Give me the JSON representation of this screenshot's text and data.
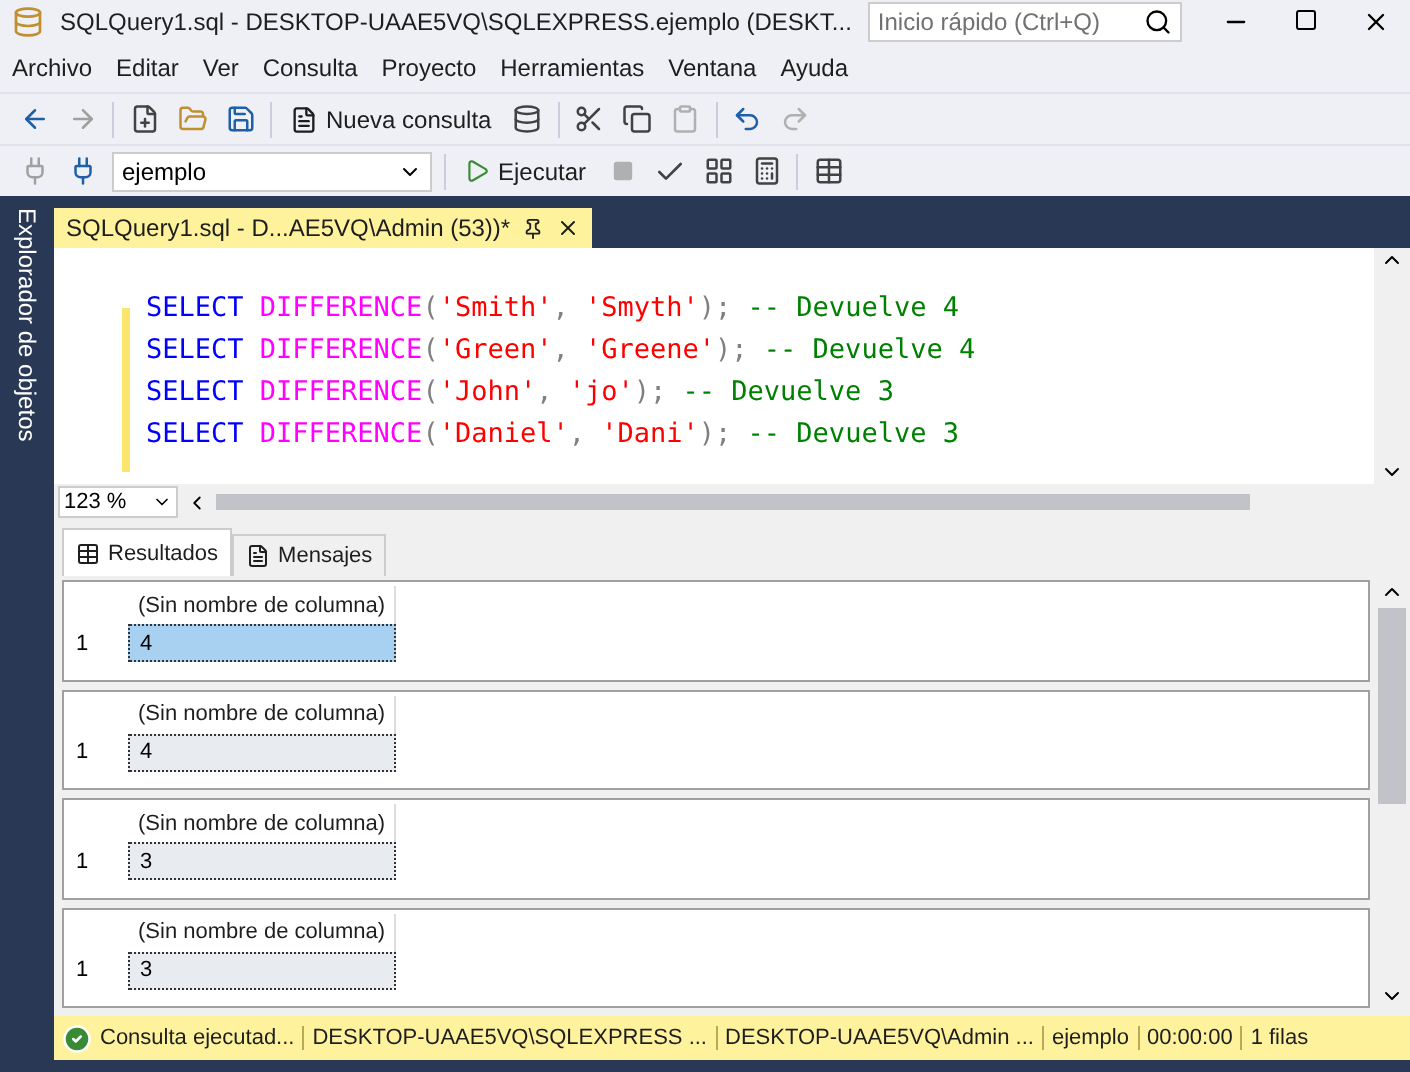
{
  "window": {
    "title": "SQLQuery1.sql - DESKTOP-UAAE5VQ\\SQLEXPRESS.ejemplo (DESKT...",
    "search_placeholder": "Inicio rápido (Ctrl+Q)"
  },
  "menu": [
    "Archivo",
    "Editar",
    "Ver",
    "Consulta",
    "Proyecto",
    "Herramientas",
    "Ventana",
    "Ayuda"
  ],
  "toolbar": {
    "new_query": "Nueva consulta",
    "database": "ejemplo",
    "execute": "Ejecutar"
  },
  "side_tab": "Explorador de objetos",
  "document_tab": {
    "title": "SQLQuery1.sql - D...AE5VQ\\Admin (53))*"
  },
  "editor": {
    "lines": [
      [
        {
          "kind": "keyword",
          "text": "SELECT "
        },
        {
          "kind": "function",
          "text": "DIFFERENCE"
        },
        {
          "kind": "punct",
          "text": "("
        },
        {
          "kind": "string",
          "text": "'Smith'"
        },
        {
          "kind": "punct",
          "text": ", "
        },
        {
          "kind": "string",
          "text": "'Smyth'"
        },
        {
          "kind": "punct",
          "text": "); "
        },
        {
          "kind": "comment",
          "text": "-- Devuelve 4"
        }
      ],
      [
        {
          "kind": "keyword",
          "text": "SELECT "
        },
        {
          "kind": "function",
          "text": "DIFFERENCE"
        },
        {
          "kind": "punct",
          "text": "("
        },
        {
          "kind": "string",
          "text": "'Green'"
        },
        {
          "kind": "punct",
          "text": ", "
        },
        {
          "kind": "string",
          "text": "'Greene'"
        },
        {
          "kind": "punct",
          "text": "); "
        },
        {
          "kind": "comment",
          "text": "-- Devuelve 4"
        }
      ],
      [
        {
          "kind": "keyword",
          "text": "SELECT "
        },
        {
          "kind": "function",
          "text": "DIFFERENCE"
        },
        {
          "kind": "punct",
          "text": "("
        },
        {
          "kind": "string",
          "text": "'John'"
        },
        {
          "kind": "punct",
          "text": ", "
        },
        {
          "kind": "string",
          "text": "'jo'"
        },
        {
          "kind": "punct",
          "text": "); "
        },
        {
          "kind": "comment",
          "text": "-- Devuelve 3"
        }
      ],
      [
        {
          "kind": "keyword",
          "text": "SELECT "
        },
        {
          "kind": "function",
          "text": "DIFFERENCE"
        },
        {
          "kind": "punct",
          "text": "("
        },
        {
          "kind": "string",
          "text": "'Daniel'"
        },
        {
          "kind": "punct",
          "text": ", "
        },
        {
          "kind": "string",
          "text": "'Dani'"
        },
        {
          "kind": "punct",
          "text": "); "
        },
        {
          "kind": "comment",
          "text": "-- Devuelve 3"
        }
      ]
    ],
    "zoom": "123 %"
  },
  "result_tabs": [
    {
      "label": "Resultados",
      "selected": true
    },
    {
      "label": "Mensajes",
      "selected": false
    }
  ],
  "grids": [
    {
      "column": "(Sin nombre de columna)",
      "row_number": "1",
      "value": "4",
      "selected": true
    },
    {
      "column": "(Sin nombre de columna)",
      "row_number": "1",
      "value": "4",
      "selected": false
    },
    {
      "column": "(Sin nombre de columna)",
      "row_number": "1",
      "value": "3",
      "selected": false
    },
    {
      "column": "(Sin nombre de columna)",
      "row_number": "1",
      "value": "3",
      "selected": false
    }
  ],
  "status_bar": [
    "Consulta  ejecutad...",
    "DESKTOP-UAAE5VQ\\SQLEXPRESS ...",
    "DESKTOP-UAAE5VQ\\Admin ...",
    "ejemplo",
    "00:00:00",
    "1 filas"
  ]
}
